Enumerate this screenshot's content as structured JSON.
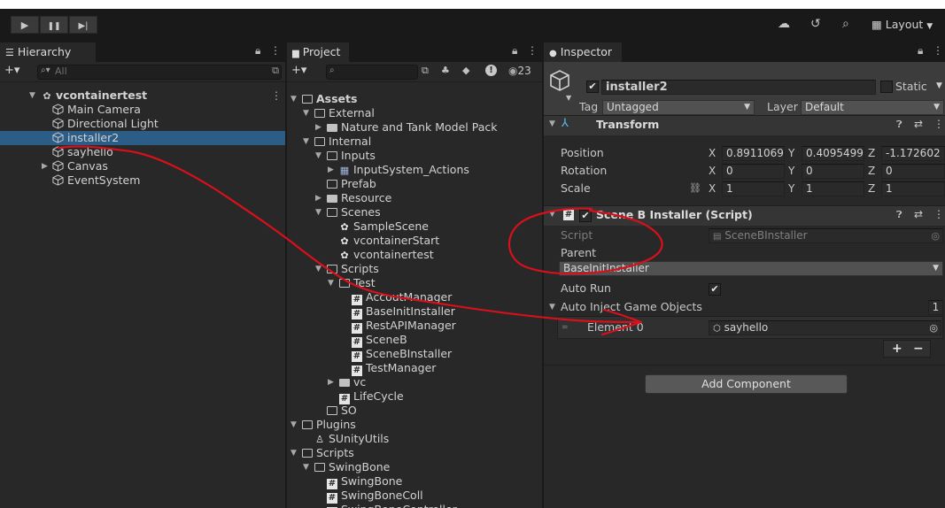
{
  "colors": {
    "accent": "#2c5d87",
    "annotation": "#d8101c"
  },
  "icons": {
    "play": "▶",
    "pause": "❚❚",
    "step": "▶|",
    "cloud": "☁",
    "history": "↺",
    "search": "⌕",
    "layout": "▦",
    "lock": "🔒︎",
    "more": "⋮",
    "help": "❓︎",
    "preset": "⇄",
    "checkmark": "✔"
  },
  "toolbar": {
    "layout_label": "Layout"
  },
  "hierarchy": {
    "tab": "Hierarchy",
    "add": "+▾",
    "search_placeholder": "All",
    "root": "vcontainertest",
    "items": [
      "Main Camera",
      "Directional Light",
      "installer2",
      "sayhello",
      "Canvas",
      "EventSystem"
    ],
    "selected": "installer2"
  },
  "project": {
    "tab": "Project",
    "add": "+▾",
    "hidden_count": "23",
    "tree": [
      "Assets",
      "External",
      "Nature and Tank Model Pack",
      "Internal",
      "Inputs",
      "InputSystem_Actions",
      "Prefab",
      "Resource",
      "Scenes",
      "SampleScene",
      "vcontainerStart",
      "vcontainertest",
      "Scripts",
      "Test",
      "AccoutManager",
      "BaseInitInstaller",
      "RestAPIManager",
      "SceneB",
      "SceneBInstaller",
      "TestManager",
      "vc",
      "LifeCycle",
      "SO",
      "Plugins",
      "SUnityUtils",
      "Scripts",
      "SwingBone",
      "SwingBone",
      "SwingBoneColl",
      "SwingBoneController"
    ]
  },
  "inspector": {
    "tab": "Inspector",
    "object_name": "installer2",
    "static_label": "Static",
    "tag_label": "Tag",
    "tag_value": "Untagged",
    "layer_label": "Layer",
    "layer_value": "Default",
    "transform": {
      "title": "Transform",
      "labels": [
        "Position",
        "Rotation",
        "Scale"
      ],
      "axes": [
        "X",
        "Y",
        "Z"
      ],
      "position": [
        "0.8911069",
        "0.4095499",
        "-1.172602"
      ],
      "rotation": [
        "0",
        "0",
        "0"
      ],
      "scale": [
        "1",
        "1",
        "1"
      ]
    },
    "component": {
      "title": "Scene B Installer (Script)",
      "script_label": "Script",
      "script_value": "SceneBInstaller",
      "parent_label": "Parent",
      "parent_value": "BaseInitInstaller",
      "autorun_label": "Auto Run",
      "auto_inject_label": "Auto Inject Game Objects",
      "auto_inject_count": "1",
      "element_label": "Element 0",
      "element_value": "sayhello",
      "plus": "+",
      "minus": "−"
    },
    "add_component": "Add Component"
  }
}
